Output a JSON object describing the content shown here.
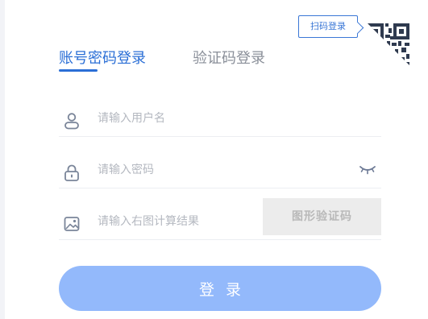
{
  "qr": {
    "tip_label": "扫码登录"
  },
  "tabs": [
    {
      "label": "账号密码登录",
      "active": true
    },
    {
      "label": "验证码登录",
      "active": false
    }
  ],
  "fields": {
    "username": {
      "placeholder": "请输入用户名",
      "value": ""
    },
    "password": {
      "placeholder": "请输入密码",
      "value": ""
    },
    "captcha": {
      "placeholder": "请输入右图计算结果",
      "value": ""
    }
  },
  "captcha_image": {
    "label": "图形验证码"
  },
  "login_button": {
    "label": "登录"
  },
  "colors": {
    "accent": "#2b6fd6",
    "button": "#93b9fb",
    "icon": "#7a8599"
  },
  "icons": [
    "qr-code-icon",
    "user-icon",
    "lock-icon",
    "eye-closed-icon",
    "image-icon"
  ]
}
